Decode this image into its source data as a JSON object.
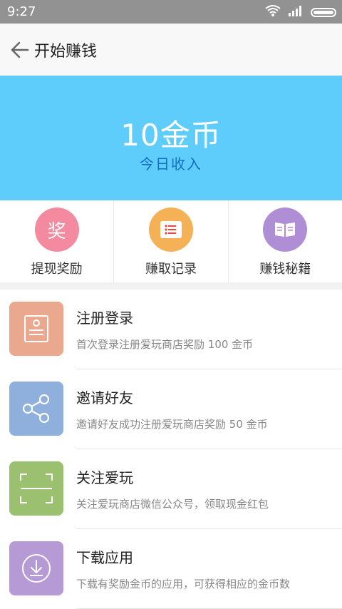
{
  "status_bar": {
    "time": "9:27"
  },
  "header": {
    "title": "开始赚钱"
  },
  "hero": {
    "amount": "10金币",
    "label": "今日收入"
  },
  "quick_actions": [
    {
      "label": "提现奖励",
      "icon": "prize-icon",
      "glyph": "奖",
      "color": "#f38a9f"
    },
    {
      "label": "赚取记录",
      "icon": "record-list-icon",
      "color": "#f4b155"
    },
    {
      "label": "赚钱秘籍",
      "icon": "book-icon",
      "color": "#b08ed6"
    }
  ],
  "tasks": [
    {
      "title": "注册登录",
      "desc": "首次登录注册爱玩商店奖励  100 金币",
      "icon": "register-card-icon",
      "color": "#eaa98e"
    },
    {
      "title": "邀请好友",
      "desc": "邀请好友成功注册爱玩商店奖励 50 金币",
      "icon": "share-icon",
      "color": "#8fb0dd"
    },
    {
      "title": "关注爱玩",
      "desc": "关注爱玩商店微信公众号，领取现金红包",
      "icon": "scan-icon",
      "color": "#9bc06f"
    },
    {
      "title": "下载应用",
      "desc": "下载有奖励金币的应用，可获得相应的金币数",
      "icon": "download-icon",
      "color": "#b59ad6"
    }
  ]
}
